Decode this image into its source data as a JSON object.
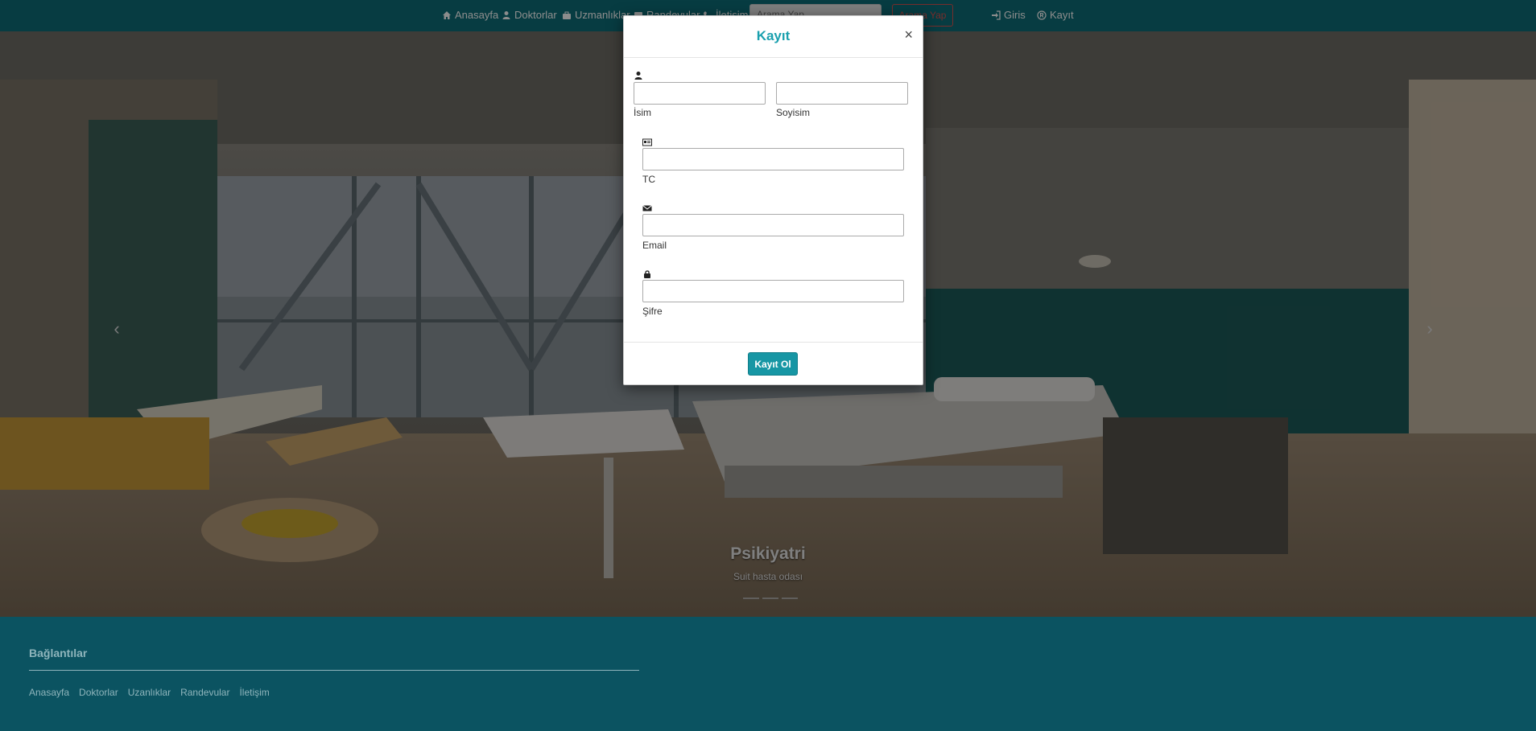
{
  "navbar": {
    "items": [
      {
        "label": "Anasayfa",
        "icon": "home-icon"
      },
      {
        "label": "Doktorlar",
        "icon": "user-icon"
      },
      {
        "label": "Uzmanlıklar",
        "icon": "briefcase-icon"
      },
      {
        "label": "Randevular",
        "icon": "calendar-icon"
      },
      {
        "label": "İletişim",
        "icon": "phone-icon"
      }
    ],
    "search_placeholder": "Arama Yap",
    "search_button": "Arama Yap",
    "login_label": "Giris",
    "register_label": "Kayıt"
  },
  "carousel": {
    "caption_title": "Psikiyatri",
    "caption_subtitle": "Suit hasta odası",
    "prev_icon": "chevron-left-icon",
    "next_icon": "chevron-right-icon"
  },
  "modal": {
    "title": "Kayıt",
    "close": "×",
    "fields": {
      "first_name_label": "İsim",
      "last_name_label": "Soyisim",
      "tc_label": "TC",
      "email_label": "Email",
      "password_label": "Şifre"
    },
    "submit_label": "Kayıt Ol"
  },
  "footer": {
    "title": "Bağlantılar",
    "links": [
      "Anasayfa",
      "Doktorlar",
      "Uzanlıklar",
      "Randevular",
      "İletişim"
    ]
  },
  "colors": {
    "navbar_bg": "#0d6e78",
    "footer_bg": "#0b5361",
    "accent": "#1aa0ae",
    "button": "#1796a4"
  }
}
